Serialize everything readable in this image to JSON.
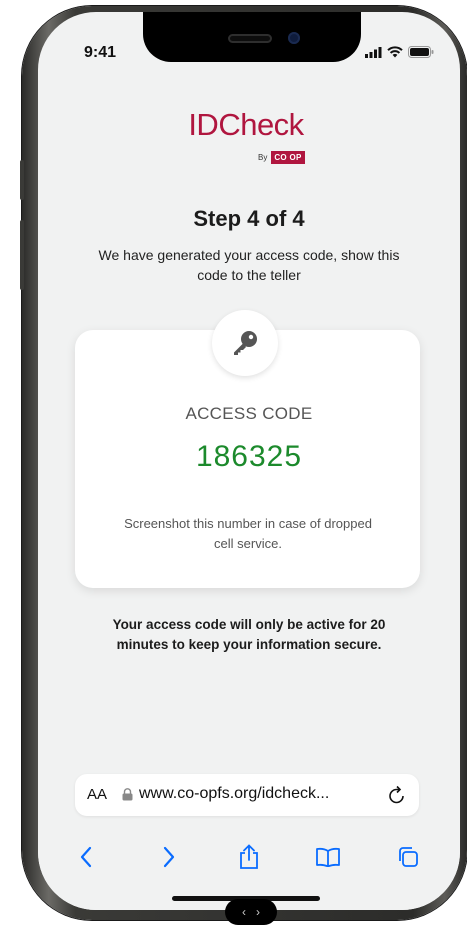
{
  "status_bar": {
    "time": "9:41"
  },
  "logo": {
    "word": "IDCheck",
    "by": "By",
    "brand": "CO OP"
  },
  "step": {
    "title": "Step 4 of 4",
    "description": "We have generated your access code, show this code to the teller"
  },
  "access": {
    "label": "ACCESS CODE",
    "code": "186325",
    "note": "Screenshot this number in case of dropped cell service."
  },
  "notice": "Your access code will only be active for 20 minutes to keep your information secure.",
  "browser": {
    "aa_label": "AA",
    "url": "www.co-opfs.org/idcheck...",
    "nav_icons": [
      "back-icon",
      "forward-icon",
      "share-icon",
      "bookmarks-icon",
      "tabs-icon"
    ]
  },
  "colors": {
    "brand": "#b0163f",
    "code": "#1c8a2c",
    "ios_blue": "#0a6cff"
  }
}
